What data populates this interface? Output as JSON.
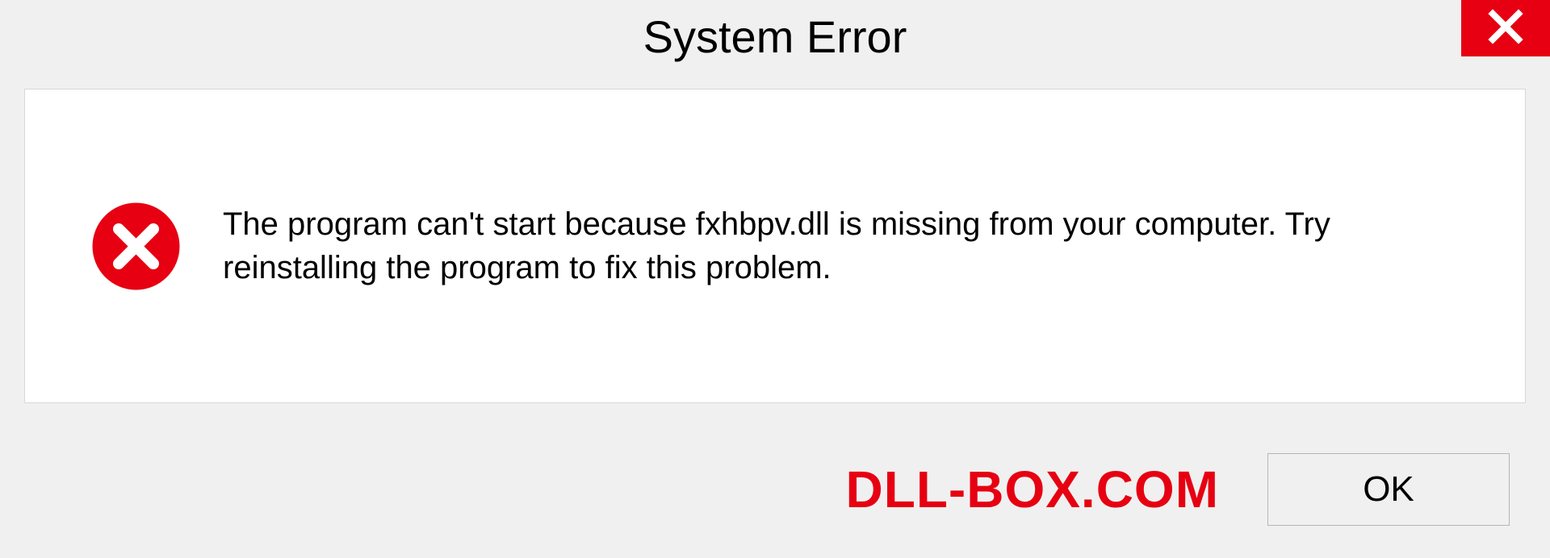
{
  "dialog": {
    "title": "System Error",
    "message": "The program can't start because fxhbpv.dll is missing from your computer. Try reinstalling the program to fix this problem.",
    "ok_label": "OK"
  },
  "watermark": "DLL-BOX.COM",
  "colors": {
    "accent_red": "#e60012",
    "background": "#f0f0f0",
    "content_bg": "#ffffff"
  }
}
